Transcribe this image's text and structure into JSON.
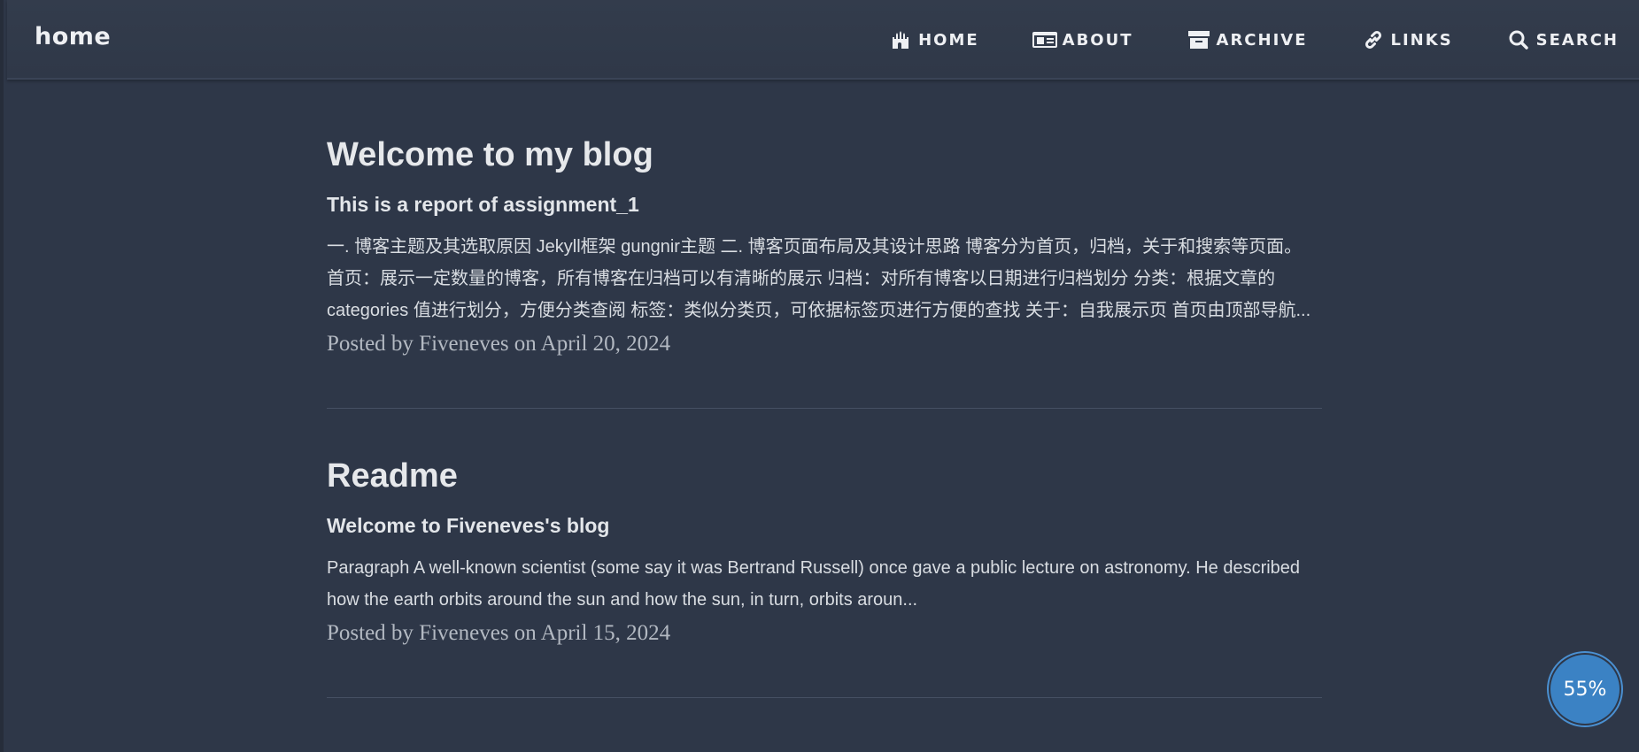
{
  "header": {
    "brand": "home",
    "nav": [
      {
        "label": "HOME",
        "icon": "castle-icon"
      },
      {
        "label": "ABOUT",
        "icon": "id-card-icon"
      },
      {
        "label": "ARCHIVE",
        "icon": "archive-icon"
      },
      {
        "label": "LINKS",
        "icon": "link-icon"
      },
      {
        "label": "SEARCH",
        "icon": "search-icon"
      }
    ]
  },
  "posts": [
    {
      "title": "Welcome to my blog",
      "subtitle": "This is a report of assignment_1",
      "excerpt": "一. 博客主题及其选取原因 Jekyll框架 gungnir主题 二. 博客页面布局及其设计思路 博客分为首页，归档，关于和搜索等页面。 首页：展示一定数量的博客，所有博客在归档可以有清晰的展示 归档：对所有博客以日期进行归档划分 分类：根据文章的 categories 值进行划分，方便分类查阅 标签：类似分类页，可依据标签页进行方便的查找 关于：自我展示页 首页由顶部导航...",
      "meta": "Posted by Fiveneves on April 20, 2024"
    },
    {
      "title": "Readme",
      "subtitle": "Welcome to Fiveneves's blog",
      "excerpt": "Paragraph A well-known scientist (some say it was Bertrand Russell) once gave a public lecture on astronomy. He described how the earth orbits around the sun and how the sun, in turn, orbits aroun...",
      "meta": "Posted by Fiveneves on April 15, 2024"
    }
  ],
  "reading_progress": {
    "label": "55%",
    "value": 0.55
  },
  "colors": {
    "background": "#2e3748",
    "navbar": "#333c4c",
    "text": "#e3e6ea",
    "meta": "#b3b9c2",
    "accent": "#3b82c4"
  }
}
